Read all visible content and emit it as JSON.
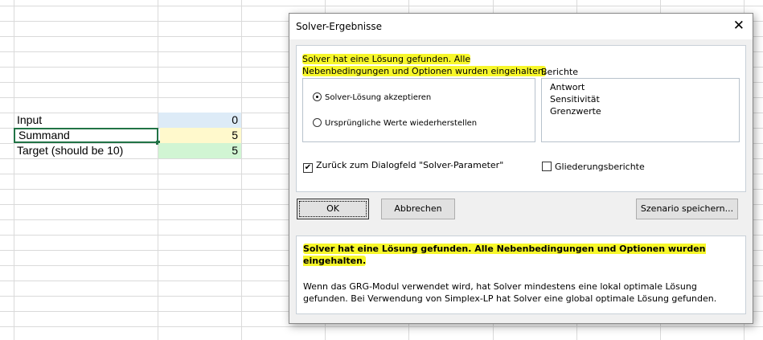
{
  "sheet": {
    "rows": [
      {
        "label": "Input",
        "value": "0",
        "fill": "#ddebf7"
      },
      {
        "label": "Summand",
        "value": "5",
        "fill": "#fff9cc"
      },
      {
        "label": "Target (should be 10)",
        "value": "5",
        "fill": "#d1f5d3"
      }
    ]
  },
  "dialog": {
    "title": "Solver-Ergebnisse",
    "message_line1": "Solver hat eine Lösung gefunden. Alle",
    "message_line2": "Nebenbedingungen und Optionen wurden eingehalten.",
    "reports_label": "Berichte",
    "reports": [
      "Antwort",
      "Sensitivität",
      "Grenzwerte"
    ],
    "radio_keep": "Solver-Lösung akzeptieren",
    "radio_restore": "Ursprüngliche Werte wiederherstellen",
    "checkbox_return": "Zurück zum Dialogfeld \"Solver-Parameter\"",
    "checkbox_outline": "Gliederungsberichte",
    "ok": "OK",
    "cancel": "Abbrechen",
    "save_scenario": "Szenario speichern...",
    "info_title": "Solver hat eine Lösung gefunden. Alle Nebenbedingungen und Optionen wurden eingehalten.",
    "info_text": "Wenn das GRG-Modul verwendet wird, hat Solver mindestens eine lokal optimale Lösung gefunden. Bei Verwendung von Simplex-LP hat Solver eine global optimale Lösung gefunden.",
    "highlight_color": "#f7f72a"
  }
}
